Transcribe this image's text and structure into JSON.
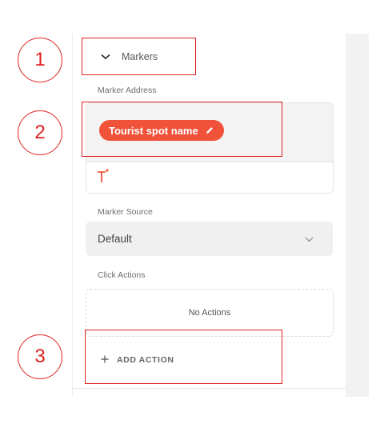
{
  "panel": {
    "section_title": "Markers",
    "marker_address_label": "Marker Address",
    "chip_label": "Tourist spot name",
    "marker_source_label": "Marker Source",
    "marker_source_value": "Default",
    "click_actions_label": "Click Actions",
    "no_actions_text": "No Actions",
    "add_action_label": "ADD ACTION"
  },
  "annotations": [
    {
      "number": "1"
    },
    {
      "number": "2"
    },
    {
      "number": "3"
    }
  ],
  "colors": {
    "accent": "#f0533a",
    "annotation": "#e02020"
  },
  "icons": {
    "collapse": "chevron-down-icon",
    "edit": "pencil-icon",
    "insert_text": "text-insert-icon",
    "select": "chevron-down-icon",
    "add": "plus-icon"
  }
}
